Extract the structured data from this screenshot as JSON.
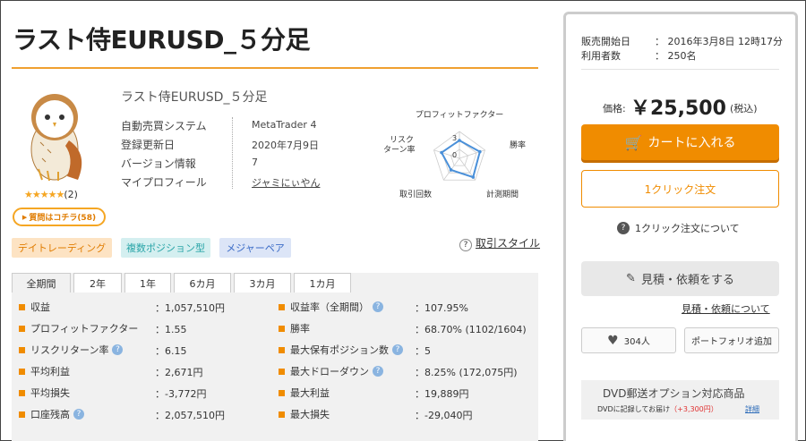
{
  "title": "ラスト侍EURUSD_５分足",
  "product": {
    "name": "ラスト侍EURUSD_５分足",
    "rating_count": "(2)",
    "stars": "★★★★★",
    "ask_label": "質問はコチラ(58)",
    "info": [
      {
        "label": "自動売買システム",
        "value": "MetaTrader 4"
      },
      {
        "label": "登録更新日",
        "value": "2020年7月9日"
      },
      {
        "label": "バージョン情報",
        "value": "7"
      },
      {
        "label": "マイプロフィール",
        "value": "ジャミにぃやん"
      }
    ]
  },
  "radar": {
    "labels": [
      "プロフィットファクター",
      "勝率",
      "計測期間",
      "取引回数",
      "リスク\nターン率"
    ],
    "label_top": "プロフィットファクター",
    "label_right": "勝率",
    "label_bottom_right": "計測期間",
    "label_bottom_left": "取引回数",
    "label_left_1": "リスク",
    "label_left_2": "ターン率",
    "scale_max": "3",
    "scale_min": "0",
    "values": [
      2,
      2.4,
      2.6,
      1.6,
      2.1
    ]
  },
  "tags": [
    "デイトレーディング",
    "複数ポジション型",
    "メジャーペア"
  ],
  "trade_style": "取引スタイル",
  "tabs": [
    "全期間",
    "2年",
    "1年",
    "6カ月",
    "3カ月",
    "1カ月"
  ],
  "stats_left": [
    {
      "label": "収益",
      "value": "：1,057,510円",
      "help": false
    },
    {
      "label": "プロフィットファクター",
      "value": "：1.55",
      "help": false
    },
    {
      "label": "リスクリターン率",
      "value": "：6.15",
      "help": true
    },
    {
      "label": "平均利益",
      "value": "：2,671円",
      "help": false
    },
    {
      "label": "平均損失",
      "value": "：-3,772円",
      "help": false
    },
    {
      "label": "口座残高",
      "value": "：2,057,510円",
      "help": true
    }
  ],
  "stats_right": [
    {
      "label": "収益率（全期間）",
      "value": "：107.95%",
      "help": true
    },
    {
      "label": "勝率",
      "value": "：68.70% (1102/1604)",
      "help": false
    },
    {
      "label": "最大保有ポジション数",
      "value": "：5",
      "help": true
    },
    {
      "label": "最大ドローダウン",
      "value": "：8.25% (172,075円)",
      "help": true
    },
    {
      "label": "最大利益",
      "value": "：19,889円",
      "help": false
    },
    {
      "label": "最大損失",
      "value": "：-29,040円",
      "help": false
    }
  ],
  "sidebar": {
    "sale_start_label": "販売開始日",
    "sale_start_value": "：  2016年3月8日 12時17分",
    "users_label": "利用者数",
    "users_value": "：  250名",
    "price_label": "価格:",
    "price_value": "￥25,500",
    "tax_label": "(税込)",
    "cart_label": "カートに入れる",
    "oneclick_label": "1クリック注文",
    "oneclick_about": "1クリック注文について",
    "quote_label": "見積・依頼をする",
    "quote_about": "見積・依頼について",
    "likes": "304人",
    "portfolio": "ポートフォリオ追加",
    "dvd_title": "DVD郵送オプション対応商品",
    "dvd_desc": "DVDに記録してお届け",
    "dvd_price": "（+3,300円）",
    "dvd_detail": "詳細"
  },
  "colors": {
    "accent": "#f08c00",
    "tag1_bg": "#fde3c3",
    "tag2_bg": "#d4eff0",
    "tag3_bg": "#dce5f7",
    "radar": "#4a90d9"
  }
}
